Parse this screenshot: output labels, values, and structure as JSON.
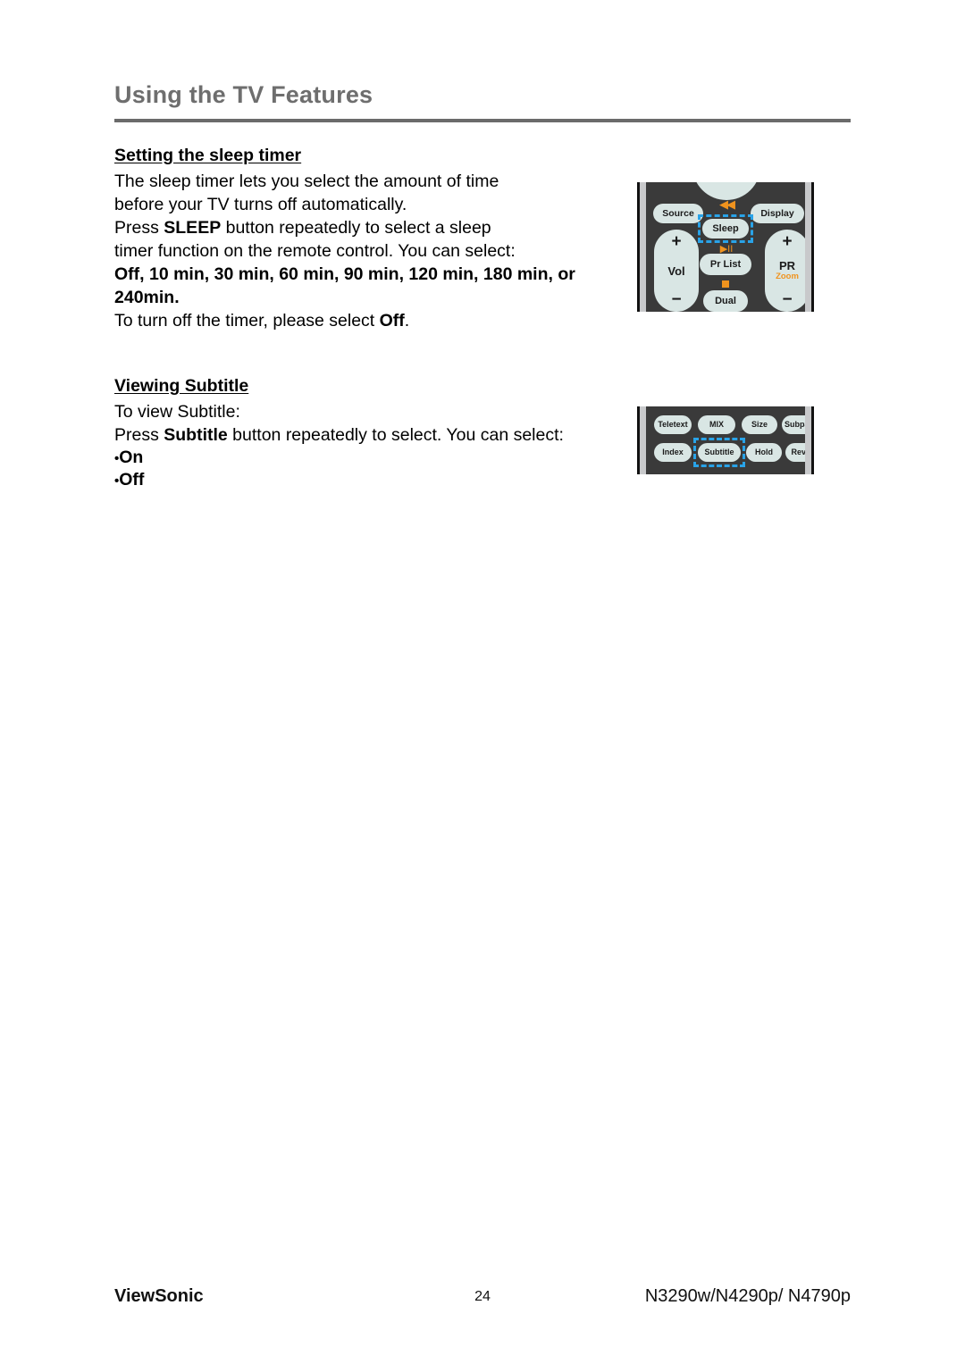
{
  "header": {
    "title": "Using the TV Features"
  },
  "sections": {
    "sleep_timer": {
      "heading": "Setting the sleep timer",
      "line1": "The sleep timer lets you select the amount of time",
      "line2": "before your TV turns off automatically.",
      "line3_a": "Press ",
      "line3_b": "SLEEP",
      "line3_c": " button repeatedly to select a sleep",
      "line4": "timer function on the remote control. You can select:",
      "options_bold": "Off, 10 min, 30 min, 60 min, 90 min, 120 min, 180 min, or 240min.",
      "closing_a": "To turn off the timer, please select ",
      "closing_b": "Off",
      "closing_c": "."
    },
    "viewing_subtitle": {
      "heading": "Viewing Subtitle",
      "line1": "To view Subtitle:",
      "line2_a": "Press ",
      "line2_b": "Subtitle",
      "line2_c": " button repeatedly to select. You can select:",
      "bullet_dot": "•",
      "bullet_on": "On",
      "bullet_off": "Off"
    }
  },
  "figures": {
    "remote_sleep": {
      "rewind_icon": "◀◀",
      "play_pause_icon": "▶II",
      "buttons": {
        "source": "Source",
        "display": "Display",
        "sleep": "Sleep",
        "pr_list": "Pr List",
        "dual": "Dual"
      },
      "rockers": {
        "vol": {
          "plus": "+",
          "label": "Vol",
          "minus": "−"
        },
        "pr": {
          "plus": "+",
          "label": "PR",
          "sublabel": "Zoom",
          "minus": "−"
        }
      }
    },
    "remote_teletext": {
      "row1": [
        "Teletext",
        "MIX",
        "Size",
        "Subpage"
      ],
      "row2": [
        "Index",
        "Subtitle",
        "Hold",
        "Reveal"
      ]
    },
    "highlight_color": "#29a3e8",
    "accent_orange": "#f0931e"
  },
  "footer": {
    "brand": "ViewSonic",
    "page_number": "24",
    "models": "N3290w/N4290p/ N4790p"
  }
}
